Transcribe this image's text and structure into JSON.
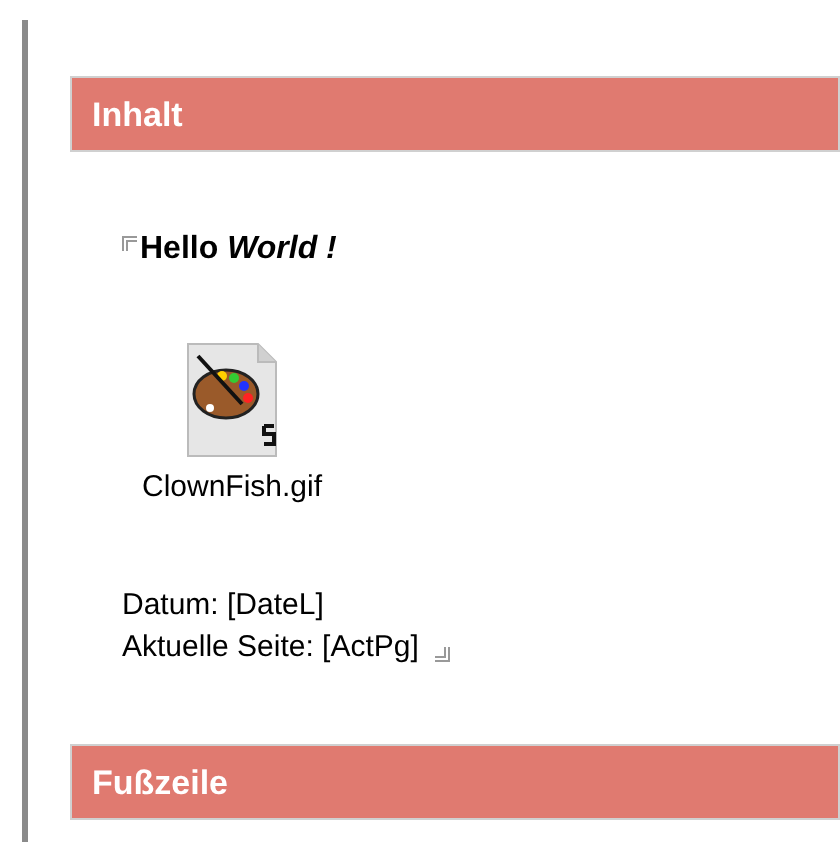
{
  "sections": [
    {
      "title": "Inhalt",
      "heading": "Hello *World !*",
      "attachment": {
        "filename": "ClownFish.gif"
      },
      "lines": [
        "Datum: [DateL]",
        "Aktuelle Seite: [ActPg]"
      ]
    },
    {
      "title": "Fußzeile"
    }
  ]
}
